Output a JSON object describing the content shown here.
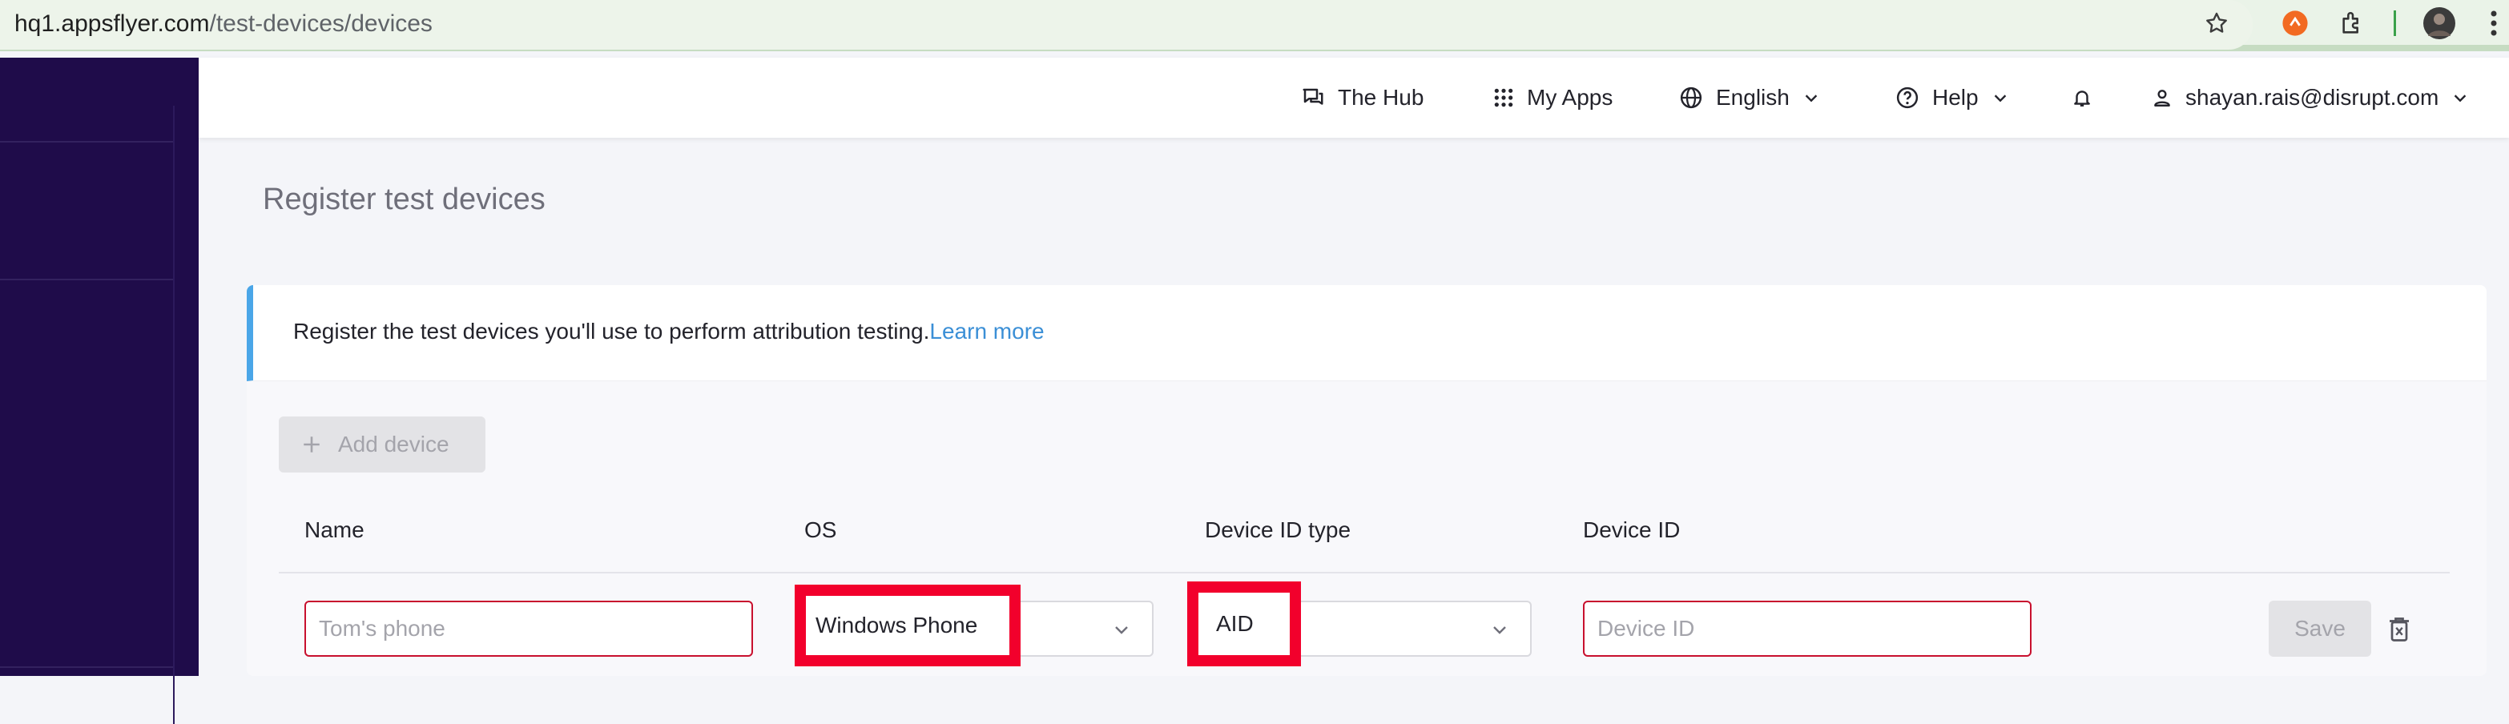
{
  "browser": {
    "url_host": "hq1.appsflyer.com",
    "url_path": "/test-devices/devices",
    "icons": [
      "star-icon",
      "extension-orange-icon",
      "puzzle-icon",
      "profile-avatar",
      "more-vert-icon"
    ]
  },
  "header": {
    "hub_label": "The Hub",
    "apps_label": "My Apps",
    "language_label": "English",
    "help_label": "Help",
    "user_label": "shayan.rais@disrupt.com"
  },
  "page": {
    "title": "Register test devices",
    "info_text": "Register the test devices you'll use to perform attribution testing.",
    "info_link": "Learn more",
    "add_device_label": "Add device"
  },
  "table": {
    "columns": [
      "Name",
      "OS",
      "Device ID type",
      "Device ID"
    ],
    "row": {
      "name_placeholder": "Tom's phone",
      "os_value": "Windows Phone",
      "id_type_value": "AID",
      "device_id_placeholder": "Device ID",
      "save_label": "Save"
    }
  },
  "colors": {
    "sidebar": "#1f0c4a",
    "link": "#3b8fd6",
    "invalid_border": "#c8102e",
    "highlight": "#f2002c",
    "info_accent": "#4aa6e8"
  }
}
